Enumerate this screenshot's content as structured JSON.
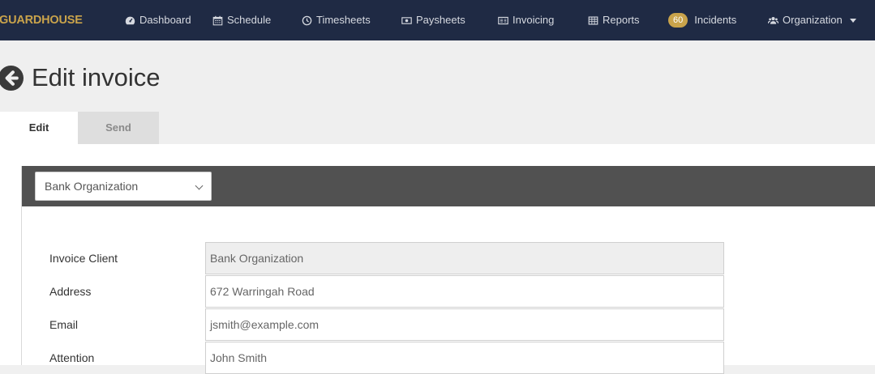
{
  "navbar": {
    "brand": "GUARDHOUSE",
    "items": [
      {
        "label": "Dashboard",
        "icon": "tachometer-icon"
      },
      {
        "label": "Schedule",
        "icon": "calendar-icon"
      },
      {
        "label": "Timesheets",
        "icon": "clock-icon"
      },
      {
        "label": "Paysheets",
        "icon": "money-icon"
      },
      {
        "label": "Invoicing",
        "icon": "invoice-icon"
      },
      {
        "label": "Reports",
        "icon": "table-icon"
      }
    ],
    "incidents": {
      "count": "60",
      "label": "Incidents"
    },
    "organization": {
      "label": "Organization",
      "icon": "users-icon"
    }
  },
  "header": {
    "title": "Edit invoice",
    "back_icon": "arrow-circle-left-icon"
  },
  "tabs": [
    {
      "label": "Edit",
      "active": true
    },
    {
      "label": "Send",
      "active": false
    }
  ],
  "panel": {
    "organization_select": {
      "value": "Bank Organization"
    }
  },
  "form": {
    "rows": [
      {
        "label": "Invoice Client",
        "value": "Bank Organization",
        "readonly": true
      },
      {
        "label": "Address",
        "value": "672 Warringah Road",
        "readonly": false
      },
      {
        "label": "Email",
        "value": "jsmith@example.com",
        "readonly": false
      },
      {
        "label": "Attention",
        "value": "John Smith",
        "readonly": false
      }
    ]
  },
  "colors": {
    "navbar_bg": "#1f2a44",
    "brand_gold": "#c9a34b",
    "panel_head": "#515151"
  }
}
